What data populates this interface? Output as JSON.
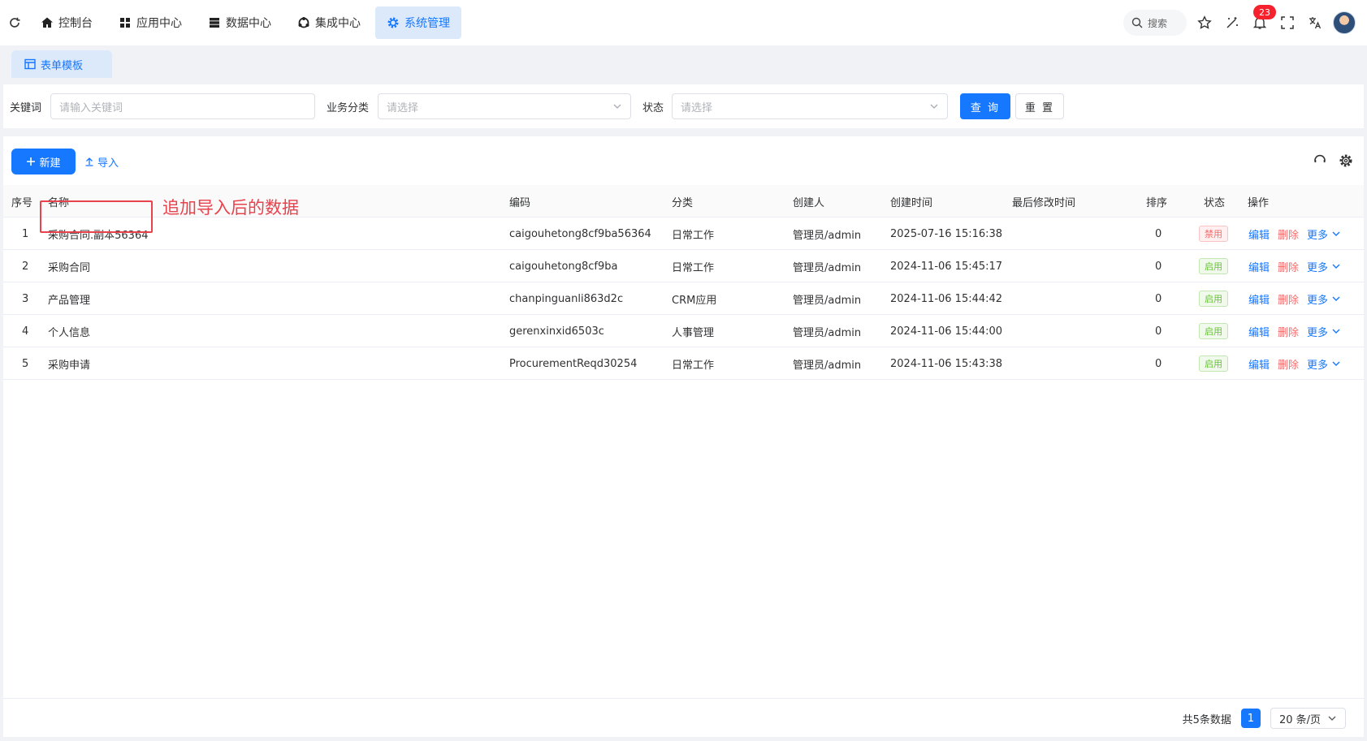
{
  "topbar": {
    "nav": [
      {
        "label": "控制台",
        "icon": "home-icon"
      },
      {
        "label": "应用中心",
        "icon": "grid-icon"
      },
      {
        "label": "数据中心",
        "icon": "database-icon"
      },
      {
        "label": "集成中心",
        "icon": "integration-icon"
      },
      {
        "label": "系统管理",
        "icon": "gear-icon",
        "active": true
      }
    ],
    "search_label": "搜索",
    "notification_count": "23"
  },
  "tab": {
    "label": "表单模板"
  },
  "filter": {
    "keyword_label": "关键词",
    "keyword_placeholder": "请输入关键词",
    "category_label": "业务分类",
    "category_placeholder": "请选择",
    "status_label": "状态",
    "status_placeholder": "请选择",
    "query_button": "查 询",
    "reset_button": "重 置"
  },
  "toolbar": {
    "new_label": "新建",
    "import_label": "导入"
  },
  "table": {
    "headers": {
      "index": "序号",
      "name": "名称",
      "code": "编码",
      "category": "分类",
      "creator": "创建人",
      "created": "创建时间",
      "modified": "最后修改时间",
      "sort": "排序",
      "status": "状态",
      "ops": "操作"
    },
    "rows": [
      {
        "index": "1",
        "name": "采购合同.副本56364",
        "code": "caigouhetong8cf9ba56364",
        "category": "日常工作",
        "creator": "管理员/admin",
        "created": "2025-07-16 15:16:38",
        "modified": "",
        "sort": "0",
        "status": "禁用",
        "status_type": "off"
      },
      {
        "index": "2",
        "name": "采购合同",
        "code": "caigouhetong8cf9ba",
        "category": "日常工作",
        "creator": "管理员/admin",
        "created": "2024-11-06 15:45:17",
        "modified": "",
        "sort": "0",
        "status": "启用",
        "status_type": "on"
      },
      {
        "index": "3",
        "name": "产品管理",
        "code": "chanpinguanli863d2c",
        "category": "CRM应用",
        "creator": "管理员/admin",
        "created": "2024-11-06 15:44:42",
        "modified": "",
        "sort": "0",
        "status": "启用",
        "status_type": "on"
      },
      {
        "index": "4",
        "name": "个人信息",
        "code": "gerenxinxid6503c",
        "category": "人事管理",
        "creator": "管理员/admin",
        "created": "2024-11-06 15:44:00",
        "modified": "",
        "sort": "0",
        "status": "启用",
        "status_type": "on"
      },
      {
        "index": "5",
        "name": "采购申请",
        "code": "ProcurementReqd30254",
        "category": "日常工作",
        "creator": "管理员/admin",
        "created": "2024-11-06 15:43:38",
        "modified": "",
        "sort": "0",
        "status": "启用",
        "status_type": "on"
      }
    ],
    "ops": {
      "edit": "编辑",
      "delete": "删除",
      "more": "更多"
    }
  },
  "annotation": "追加导入后的数据",
  "pagination": {
    "total_text": "共5条数据",
    "current_page": "1",
    "page_size": "20 条/页"
  },
  "colors": {
    "primary": "#1677ff",
    "danger": "#f56c6c",
    "success": "#67c23a",
    "annotation": "#e8424c"
  }
}
